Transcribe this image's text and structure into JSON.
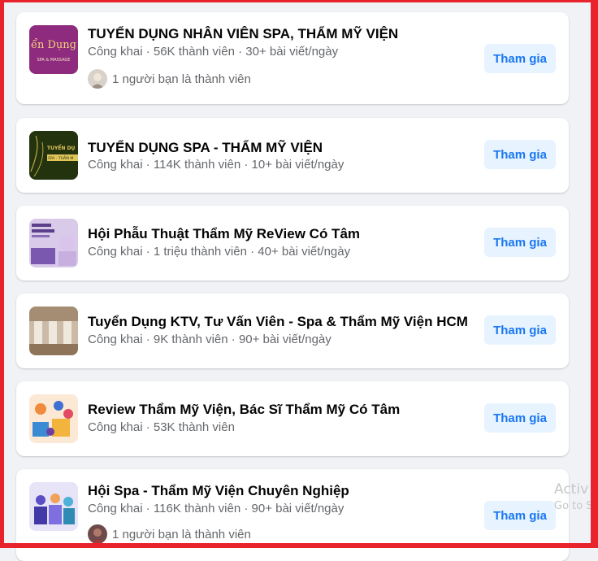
{
  "groups": [
    {
      "name": "TUYỂN DỤNG NHÂN VIÊN SPA, THẨM MỸ VIỆN",
      "meta": "Công khai · 56K thành viên · 30+ bài viết/ngày",
      "friends": "1 người bạn là thành viên",
      "button": "Tham gia",
      "thumb_text": "ển Dụng",
      "thumb_sub": "SPA & MASSAGE"
    },
    {
      "name": "TUYỂN DỤNG SPA - THẨM MỸ VIỆN",
      "meta": "Công khai · 114K thành viên · 10+ bài viết/ngày",
      "button": "Tham gia",
      "thumb_text": "TUYỂN DỤ",
      "thumb_sub": "SPA - THẨM M"
    },
    {
      "name": "Hội Phẫu Thuật Thẩm Mỹ ReView Có Tâm",
      "meta": "Công khai · 1 triệu thành viên · 40+ bài viết/ngày",
      "button": "Tham gia"
    },
    {
      "name": "Tuyển Dụng KTV, Tư Vấn Viên - Spa & Thẩm Mỹ Viện HCM",
      "meta": "Công khai · 9K thành viên · 90+ bài viết/ngày",
      "button": "Tham gia"
    },
    {
      "name": "Review Thẩm Mỹ Viện, Bác Sĩ Thẩm Mỹ Có Tâm",
      "meta": "Công khai · 53K thành viên",
      "button": "Tham gia"
    },
    {
      "name": "Hội Spa - Thẩm Mỹ Viện Chuyên Nghiệp",
      "meta": "Công khai · 116K thành viên · 90+ bài viết/ngày",
      "friends": "1 người bạn là thành viên",
      "button": "Tham gia"
    }
  ],
  "overlay": {
    "line1": "Activ",
    "line2": "Go to S"
  },
  "colors": {
    "frame": "#e8232b",
    "button_bg": "#e7f3ff",
    "button_text": "#1877f2",
    "meta_text": "#65676b"
  }
}
